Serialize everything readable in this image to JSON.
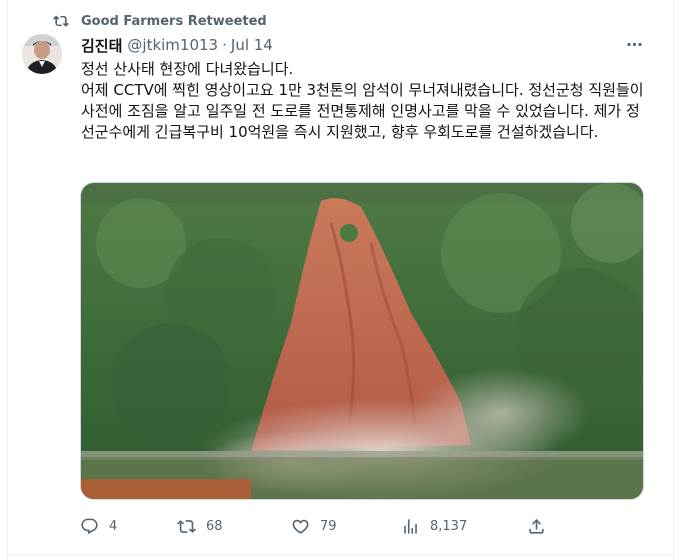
{
  "retweet_label": "Good Farmers Retweeted",
  "author": {
    "name": "김진태",
    "handle": "@jtkim1013",
    "separator": "·",
    "date": "Jul 14"
  },
  "tweet": {
    "lines": [
      "정선 산사태 현장에 다녀왔습니다.",
      "어제 CCTV에 찍힌 영상이고요 1만 3천톤의 암석이 무너져내렸습니다. 정선군청 직원들이 사전에 조짐을 알고 일주일 전 도로를 전면통제해 인명사고를 막을 수 있었습니다. 제가 정선군수에게 긴급복구비 10억원을 즉시 지원했고, 향후 우회도로를 건설하겠습니다."
    ]
  },
  "actions": {
    "replies": "4",
    "retweets": "68",
    "likes": "79",
    "views": "8,137"
  },
  "icons": {
    "retweet": "retweet-icon",
    "more": "more-icon",
    "reply": "reply-icon",
    "like": "heart-icon",
    "views": "views-icon",
    "share": "share-icon"
  },
  "colors": {
    "text_primary": "#0f1419",
    "text_secondary": "#536471",
    "border": "#cfd9de"
  }
}
